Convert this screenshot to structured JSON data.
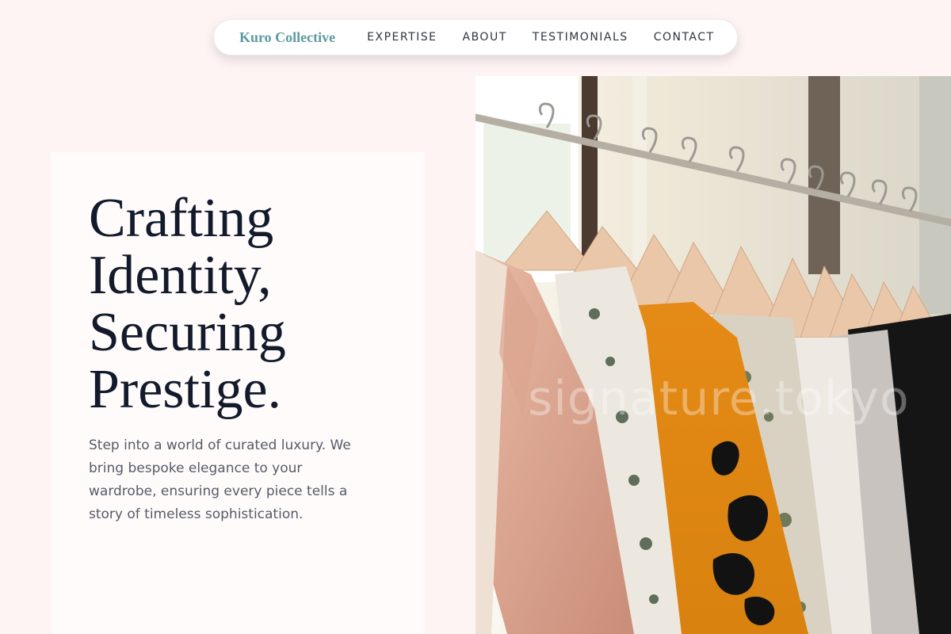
{
  "nav": {
    "brand": "Kuro Collective",
    "links": [
      "EXPERTISE",
      "ABOUT",
      "TESTIMONIALS",
      "CONTACT"
    ]
  },
  "hero": {
    "title_lines": [
      "Crafting",
      "Identity,",
      "Securing",
      "Prestige."
    ],
    "body": "Step into a world of curated luxury. We bring bespoke elegance to your wardrobe, ensuring every piece tells a story of timeless sophistication."
  },
  "photo": {
    "subject": "clothing-rack-photo",
    "watermark": "signature.tokyo"
  },
  "colors": {
    "page_bg": "#fef4f4",
    "card_bg": "#fffbfb",
    "brand": "#5b9aa0",
    "title": "#121a2b",
    "body_text": "#555b66"
  }
}
